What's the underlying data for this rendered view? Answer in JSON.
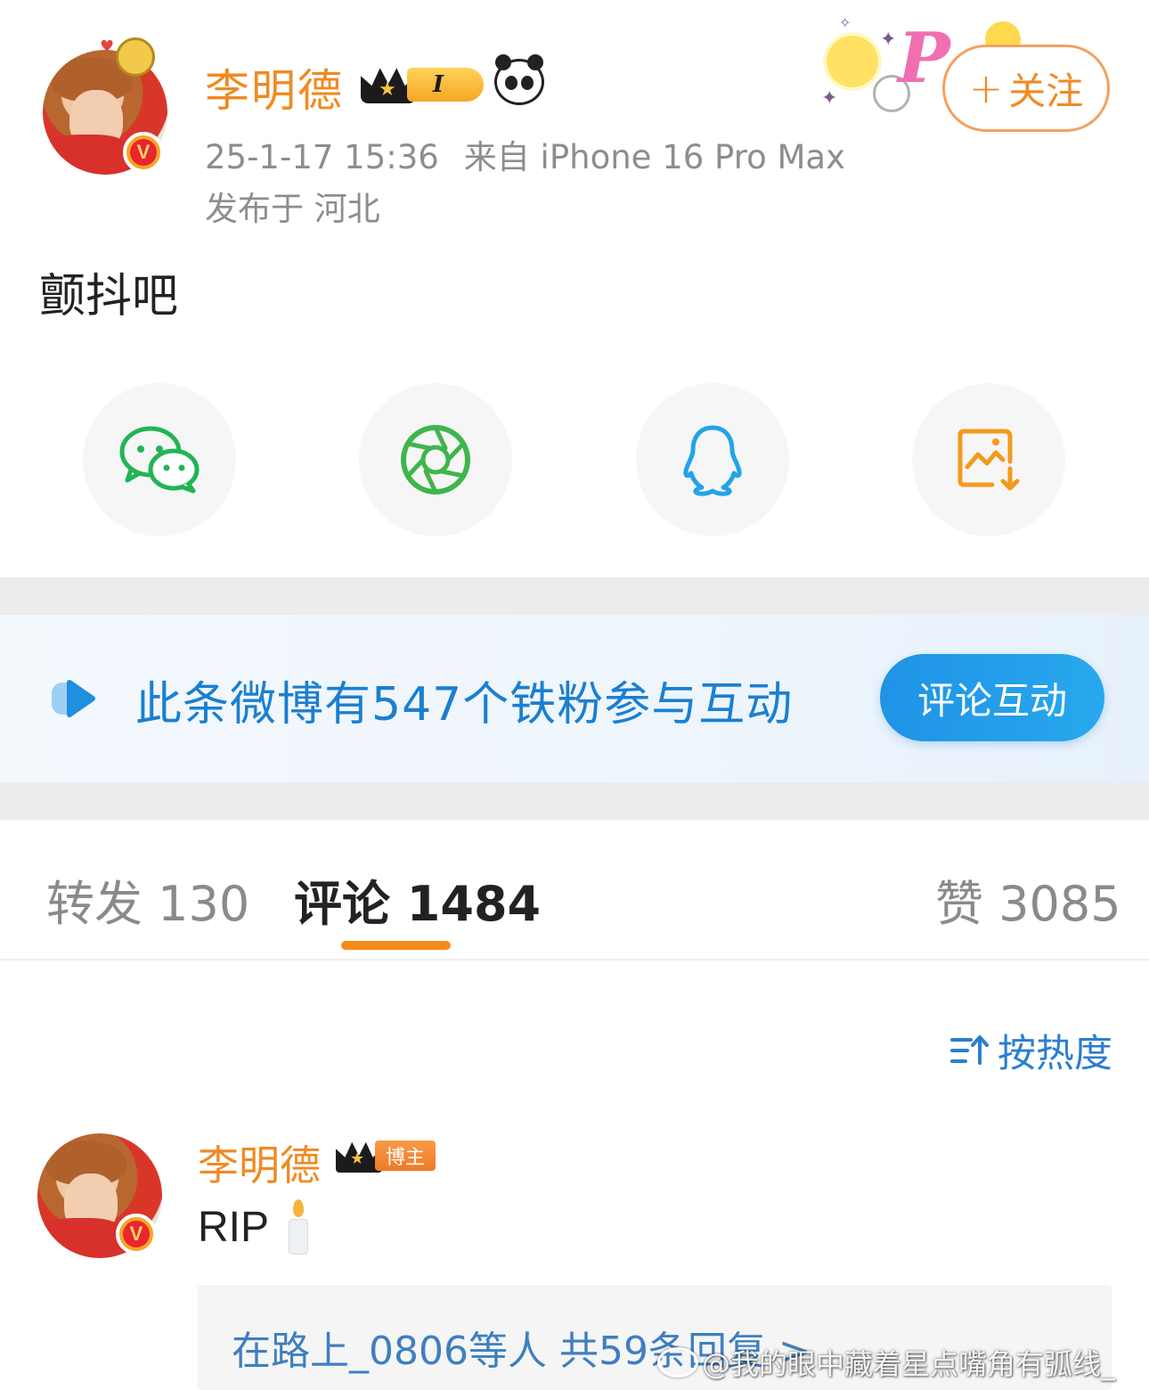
{
  "post": {
    "author_name": "李明德",
    "level_badge": "I",
    "timestamp": "25-1-17 15:36",
    "source": "来自 iPhone 16 Pro Max",
    "location": "发布于 河北",
    "text": "颤抖吧",
    "follow_label": "关注",
    "follow_icon": "+"
  },
  "share": {
    "items": [
      {
        "icon": "wechat-icon",
        "color": "#22b454"
      },
      {
        "icon": "moments-icon",
        "color": "#3fb54c"
      },
      {
        "icon": "qq-icon",
        "color": "#23a3e8"
      },
      {
        "icon": "save-image-icon",
        "color": "#f39a1c"
      }
    ]
  },
  "fans_banner": {
    "text": "此条微博有547个铁粉参与互动",
    "button_label": "评论互动"
  },
  "tabs": {
    "repost": "转发 130",
    "comments": "评论 1484",
    "likes": "赞 3085",
    "active": "comments"
  },
  "sort": {
    "label": "按热度",
    "icon": "sort-icon"
  },
  "comment": {
    "author_name": "李明德",
    "author_tag": "博主",
    "text": "RIP",
    "emoji": "candle-emoji",
    "replies_summary": "在路上_0806等人  共59条回复 >"
  },
  "watermark": {
    "text": "@我的眼中藏着星点嘴角有弧线_"
  },
  "colors": {
    "orange_accent": "#f08a22",
    "blue_accent": "#1b7fd0",
    "tab_indicator": "#f78a1c",
    "separator": "#ececec"
  }
}
